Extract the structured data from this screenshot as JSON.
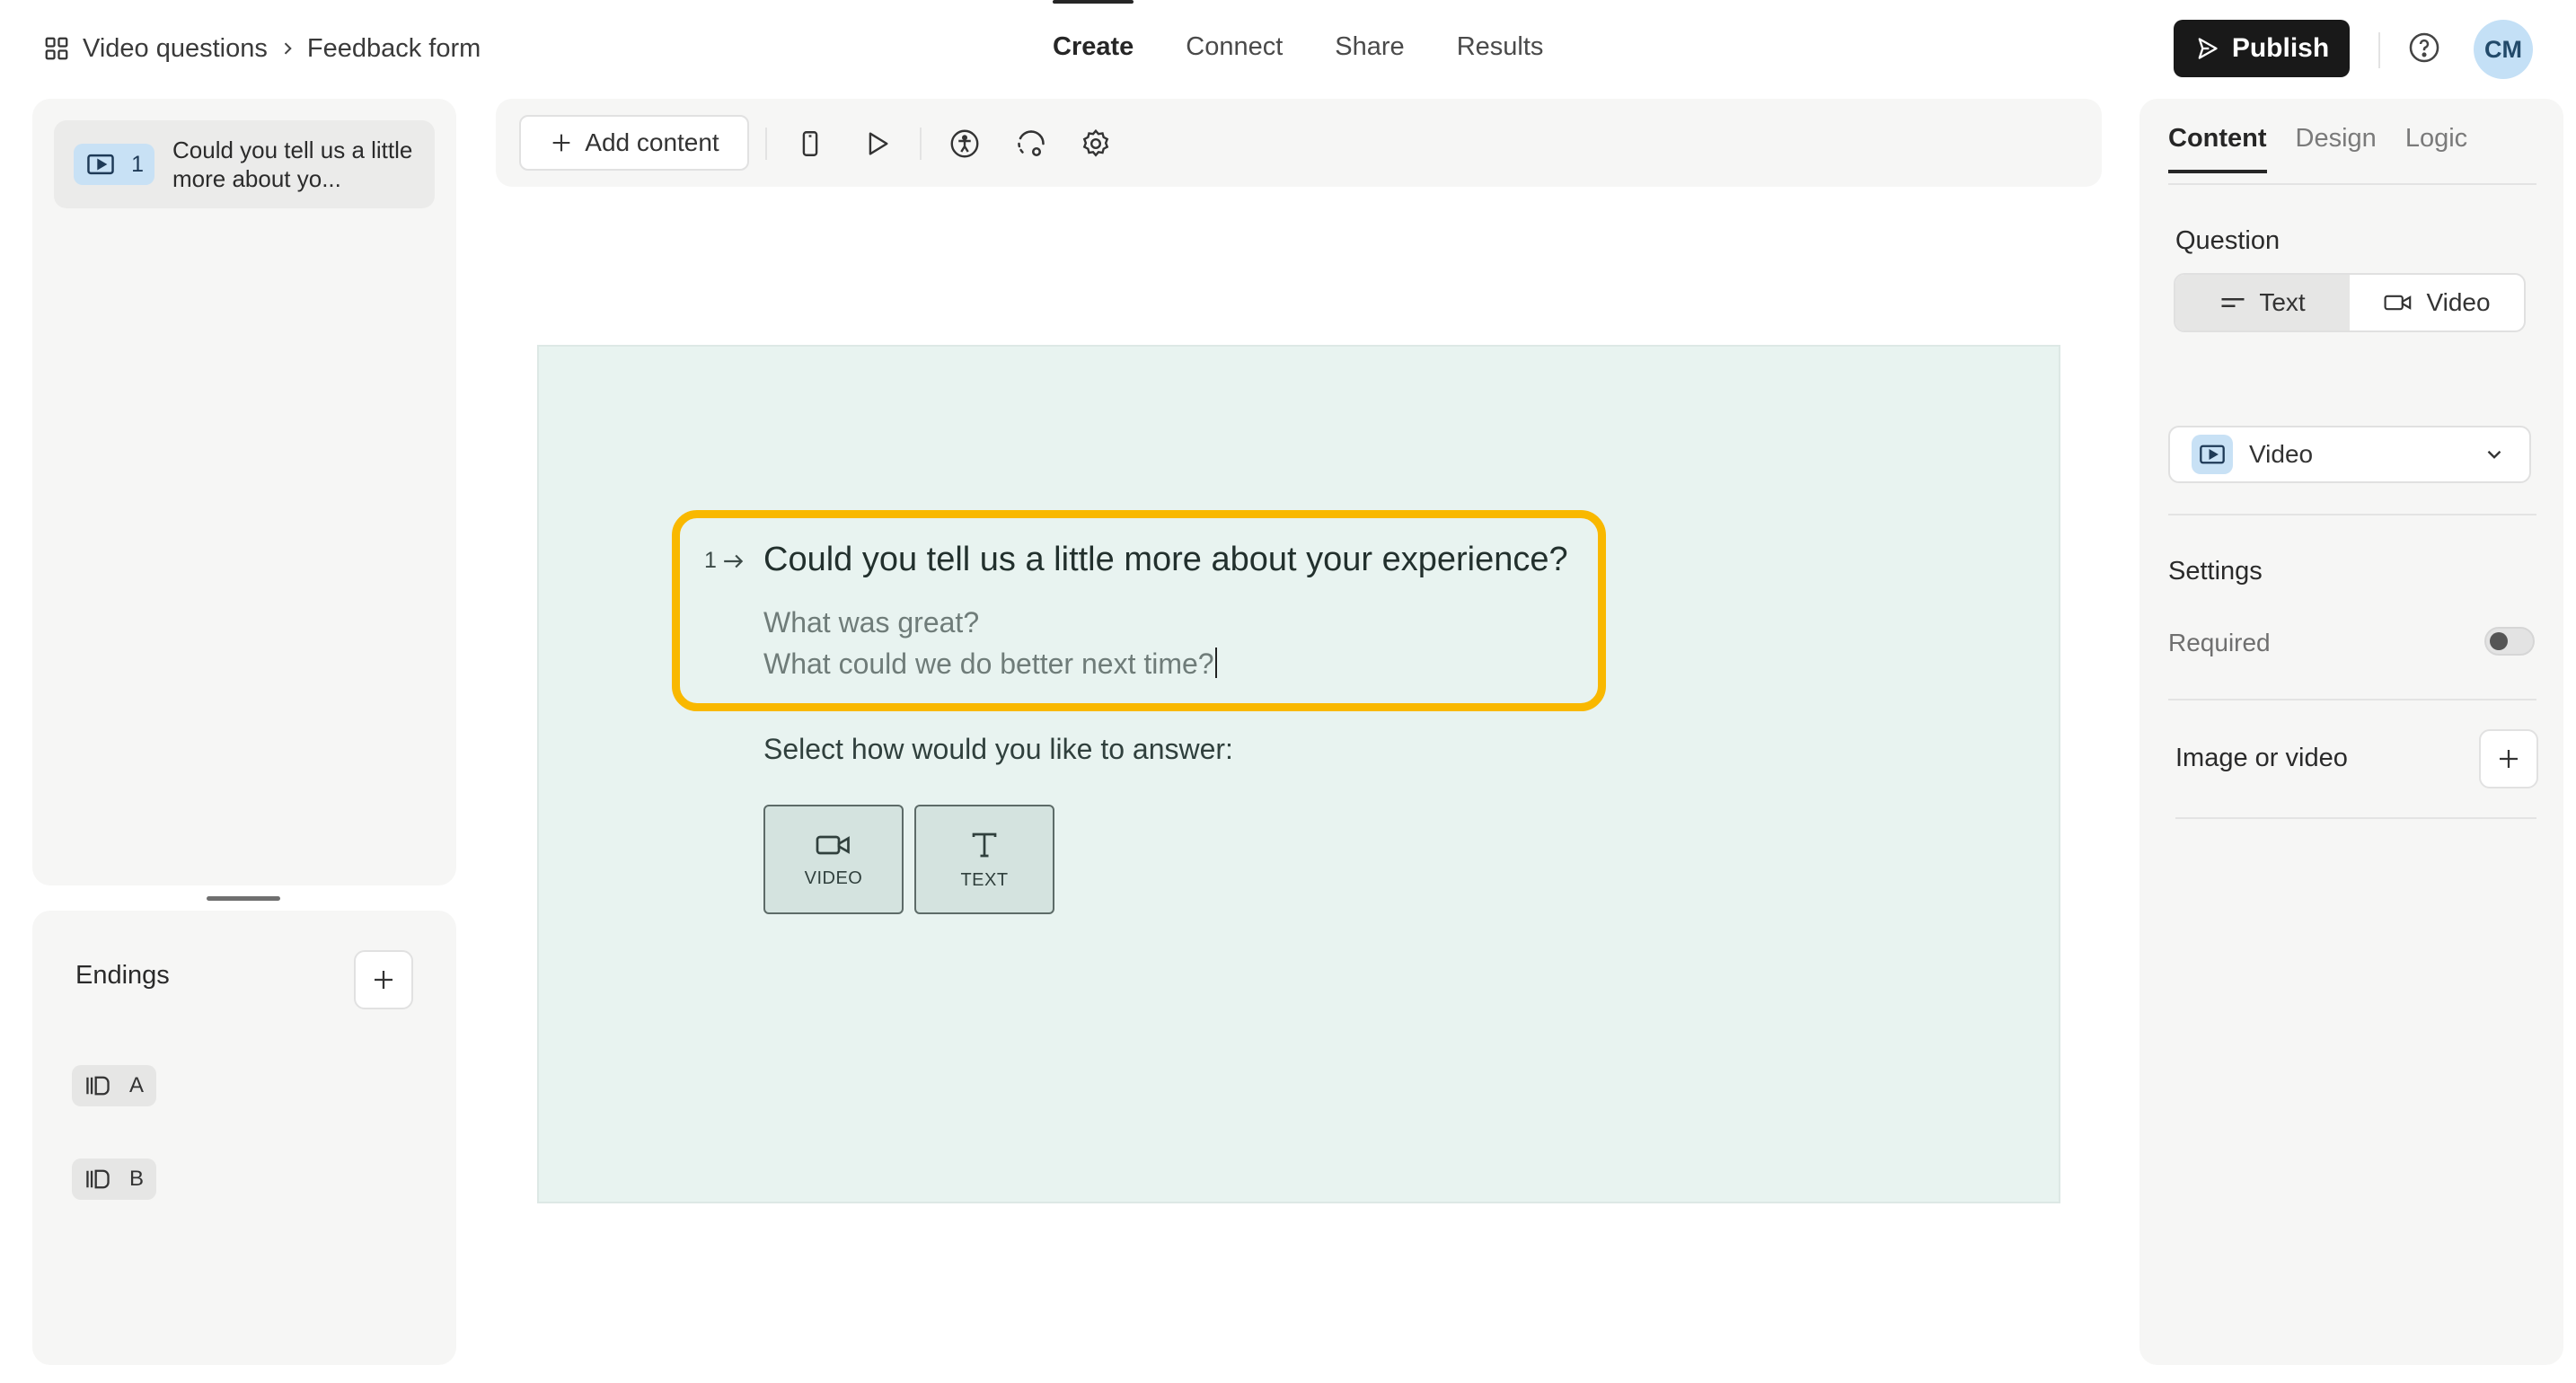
{
  "breadcrumb": {
    "workspace": "Video questions",
    "form": "Feedback form"
  },
  "nav": {
    "tabs": [
      "Create",
      "Connect",
      "Share",
      "Results"
    ],
    "active": "Create"
  },
  "header": {
    "publish_label": "Publish",
    "avatar_initials": "CM"
  },
  "sidebar": {
    "question": {
      "number": "1",
      "title": "Could you tell us a little more about yo..."
    },
    "endings_label": "Endings",
    "endings": [
      "A",
      "B"
    ]
  },
  "toolbar": {
    "add_content_label": "Add content"
  },
  "canvas": {
    "question_number": "1",
    "question_title": "Could you tell us a little more about your experience?",
    "description_lines": [
      "What was great?",
      "What could we do better next time?"
    ],
    "select_prompt": "Select how would you like to answer:",
    "answer_options": [
      "VIDEO",
      "TEXT"
    ],
    "highlight_color": "#F9B800"
  },
  "right_panel": {
    "tabs": [
      "Content",
      "Design",
      "Logic"
    ],
    "active_tab": "Content",
    "question_label": "Question",
    "question_type_options": [
      "Text",
      "Video"
    ],
    "question_type_selected": "Text",
    "block_type": "Video",
    "settings_label": "Settings",
    "required_label": "Required",
    "required_on": false,
    "image_or_video_label": "Image or video"
  }
}
